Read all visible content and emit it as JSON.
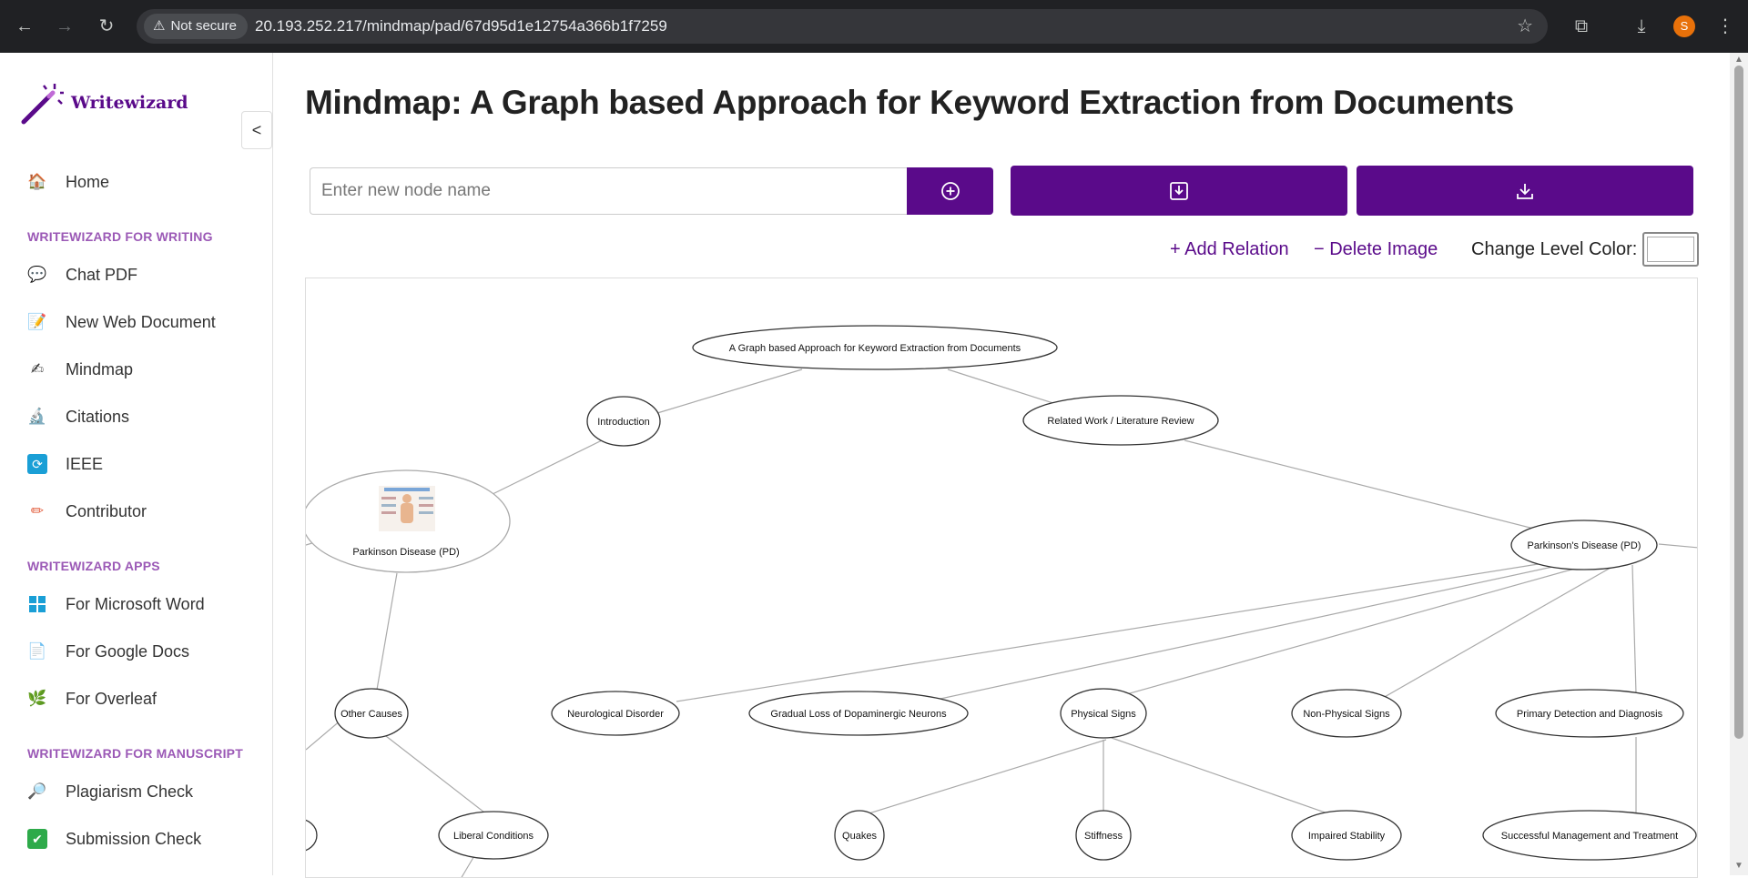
{
  "browser": {
    "security_label": "Not secure",
    "url": "20.193.252.217/mindmap/pad/67d95d1e12754a366b1f7259",
    "profile_initial": "S"
  },
  "sidebar": {
    "logo_text": "Writewizard",
    "collapse_label": "<",
    "home": "Home",
    "section_writing": "WRITEWIZARD FOR WRITING",
    "writing_items": [
      "Chat PDF",
      "New Web Document",
      "Mindmap",
      "Citations",
      "IEEE",
      "Contributor"
    ],
    "section_apps": "WRITEWIZARD APPS",
    "app_items": [
      "For Microsoft Word",
      "For Google Docs",
      "For Overleaf"
    ],
    "section_manuscript": "WRITEWIZARD FOR MANUSCRIPT",
    "manuscript_items": [
      "Plagiarism Check",
      "Submission Check"
    ]
  },
  "main": {
    "title": "Mindmap: A Graph based Approach for Keyword Extraction from Documents",
    "node_input_placeholder": "Enter new node name",
    "add_relation": "+ Add Relation",
    "delete_image": "− Delete Image",
    "change_level_color": "Change Level Color:"
  },
  "mindmap": {
    "nodes": [
      {
        "id": "root",
        "label": "A Graph based Approach for Keyword Extraction from Documents"
      },
      {
        "id": "intro",
        "label": "Introduction"
      },
      {
        "id": "related",
        "label": "Related Work / Literature Review"
      },
      {
        "id": "pd_img",
        "label": "Parkinson Disease (PD)"
      },
      {
        "id": "pd",
        "label": "Parkinson's Disease (PD)"
      },
      {
        "id": "other",
        "label": "Other Causes"
      },
      {
        "id": "neuro",
        "label": "Neurological Disorder"
      },
      {
        "id": "gradual",
        "label": "Gradual Loss of Dopaminergic Neurons"
      },
      {
        "id": "physical",
        "label": "Physical Signs"
      },
      {
        "id": "nonphysical",
        "label": "Non-Physical Signs"
      },
      {
        "id": "primary",
        "label": "Primary Detection and Diagnosis"
      },
      {
        "id": "liberal",
        "label": "Liberal Conditions"
      },
      {
        "id": "quakes",
        "label": "Quakes"
      },
      {
        "id": "stiffness",
        "label": "Stiffness"
      },
      {
        "id": "impaired",
        "label": "Impaired Stability"
      },
      {
        "id": "successful",
        "label": "Successful Management and Treatment"
      }
    ]
  }
}
